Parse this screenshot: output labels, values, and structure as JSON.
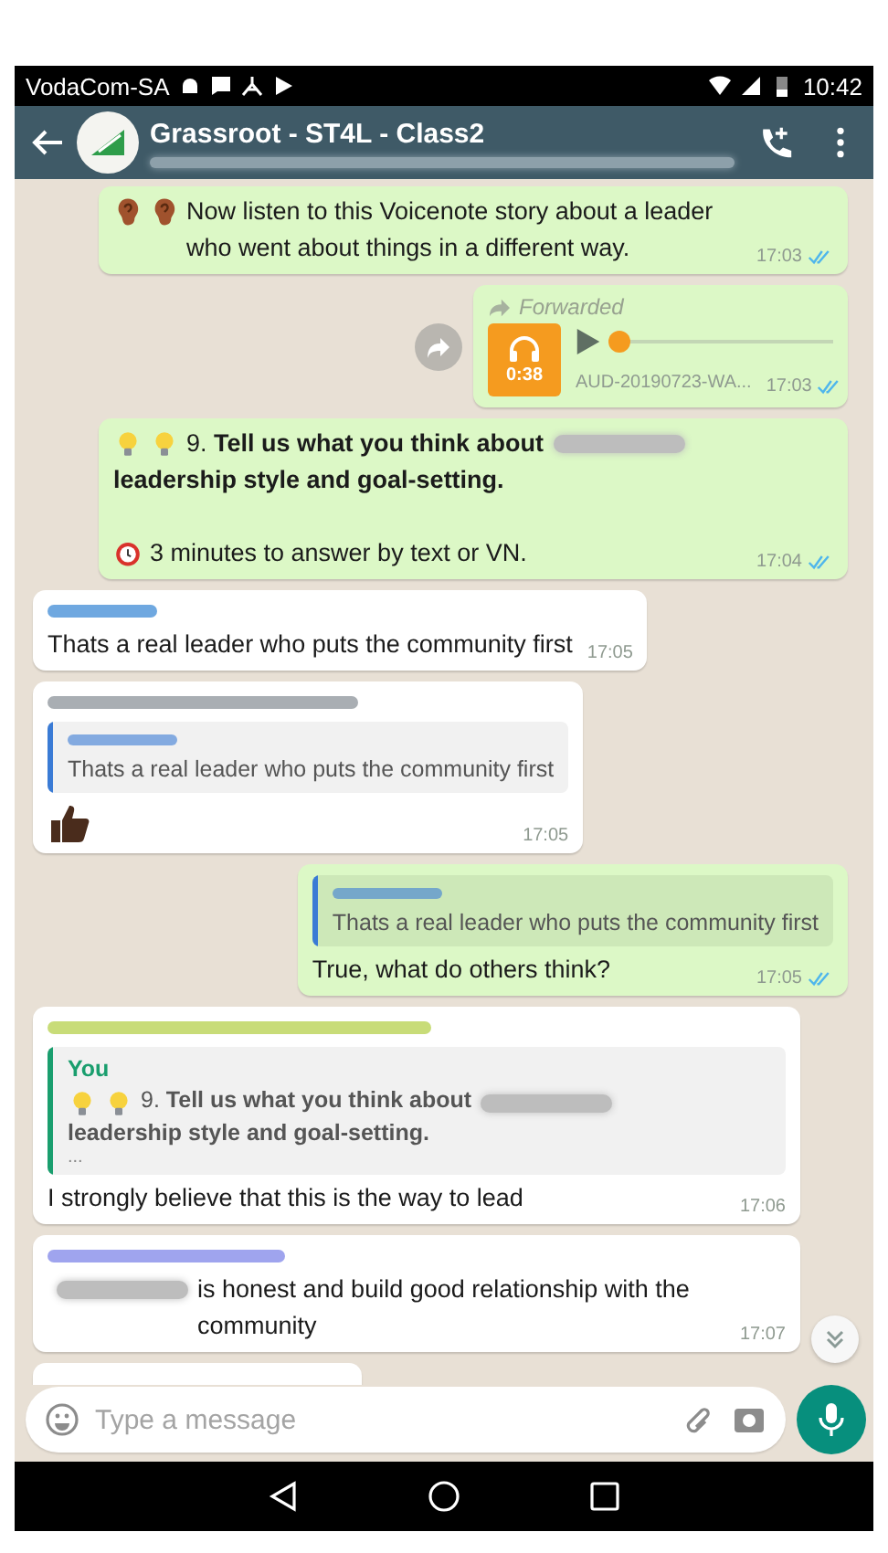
{
  "status_bar": {
    "carrier": "VodaCom-SA",
    "time": "10:42"
  },
  "header": {
    "title": "Grassroot - ST4L - Class2"
  },
  "messages": [
    {
      "outgoing": true,
      "kind": "text",
      "paragraphs": [
        [
          {
            "kind": "ear"
          },
          {
            "kind": "ear"
          },
          {
            "kind": "text",
            "text": "Now listen to this Voicenote story about a leader who went about things in a different way."
          }
        ]
      ],
      "time": "17:03",
      "read": true
    },
    {
      "outgoing": true,
      "kind": "audio",
      "forwarded": "Forwarded",
      "duration": "0:38",
      "level": 0.03,
      "file": "AUD-20190723-WA...",
      "time": "17:03",
      "read": true
    },
    {
      "outgoing": true,
      "kind": "text",
      "paragraphs": [
        [
          {
            "kind": "bulb"
          },
          {
            "kind": "bulb"
          },
          {
            "kind": "text",
            "text": "9. **Tell us what you think about**"
          },
          {
            "kind": "blur"
          },
          {
            "kind": "text",
            "text": "**leadership style and goal-setting.**"
          }
        ],
        [
          {
            "kind": "alarm"
          },
          {
            "kind": "text",
            "text": "3 minutes to answer by text or VN."
          }
        ]
      ],
      "time": "17:04",
      "read": true
    },
    {
      "outgoing": false,
      "kind": "text",
      "sender": {
        "color": "#6fa8e0"
      },
      "paragraphs": [
        [
          {
            "kind": "text",
            "text": "Thats a real leader who puts the community first"
          }
        ]
      ],
      "time": "17:05"
    },
    {
      "outgoing": false,
      "kind": "text",
      "sender": {
        "color": "#a9aeb3"
      },
      "quote": {
        "color": "#3a7bd5",
        "parts": [
          {
            "kind": "text",
            "text": "Thats a real leader who puts the community first"
          }
        ]
      },
      "paragraphs": [
        [
          {
            "kind": "thumbs_up"
          }
        ]
      ],
      "time": "17:05"
    },
    {
      "outgoing": true,
      "kind": "text",
      "quote": {
        "color": "#3a7bd5",
        "parts": [
          {
            "kind": "text",
            "text": "Thats a real leader who puts the community first"
          }
        ]
      },
      "paragraphs": [
        [
          {
            "kind": "text",
            "text": "True, what do others think?"
          }
        ]
      ],
      "time": "17:05",
      "read": true
    },
    {
      "outgoing": false,
      "kind": "text",
      "sender": {
        "color": "#c8dc78"
      },
      "quote": {
        "author": "You",
        "color": "#1a9e6e",
        "parts": [
          {
            "kind": "bulb"
          },
          {
            "kind": "bulb"
          },
          {
            "kind": "text",
            "text": "9. **Tell us what you think about**"
          },
          {
            "kind": "blur"
          },
          {
            "kind": "text",
            "text": "**leadership style and goal-setting.**"
          }
        ],
        "more": "..."
      },
      "paragraphs": [
        [
          {
            "kind": "text",
            "text": "I strongly believe that this is the way to lead"
          }
        ]
      ],
      "time": "17:06"
    },
    {
      "outgoing": false,
      "kind": "text",
      "sender": {
        "color": "#9fa4ee"
      },
      "paragraphs": [
        [
          {
            "kind": "blur"
          },
          {
            "kind": "text",
            "text": "is honest and build good relationship with the community"
          }
        ]
      ],
      "time": "17:07"
    },
    {
      "outgoing": false,
      "kind": "partial"
    }
  ],
  "composer": {
    "placeholder": "Type a message"
  }
}
